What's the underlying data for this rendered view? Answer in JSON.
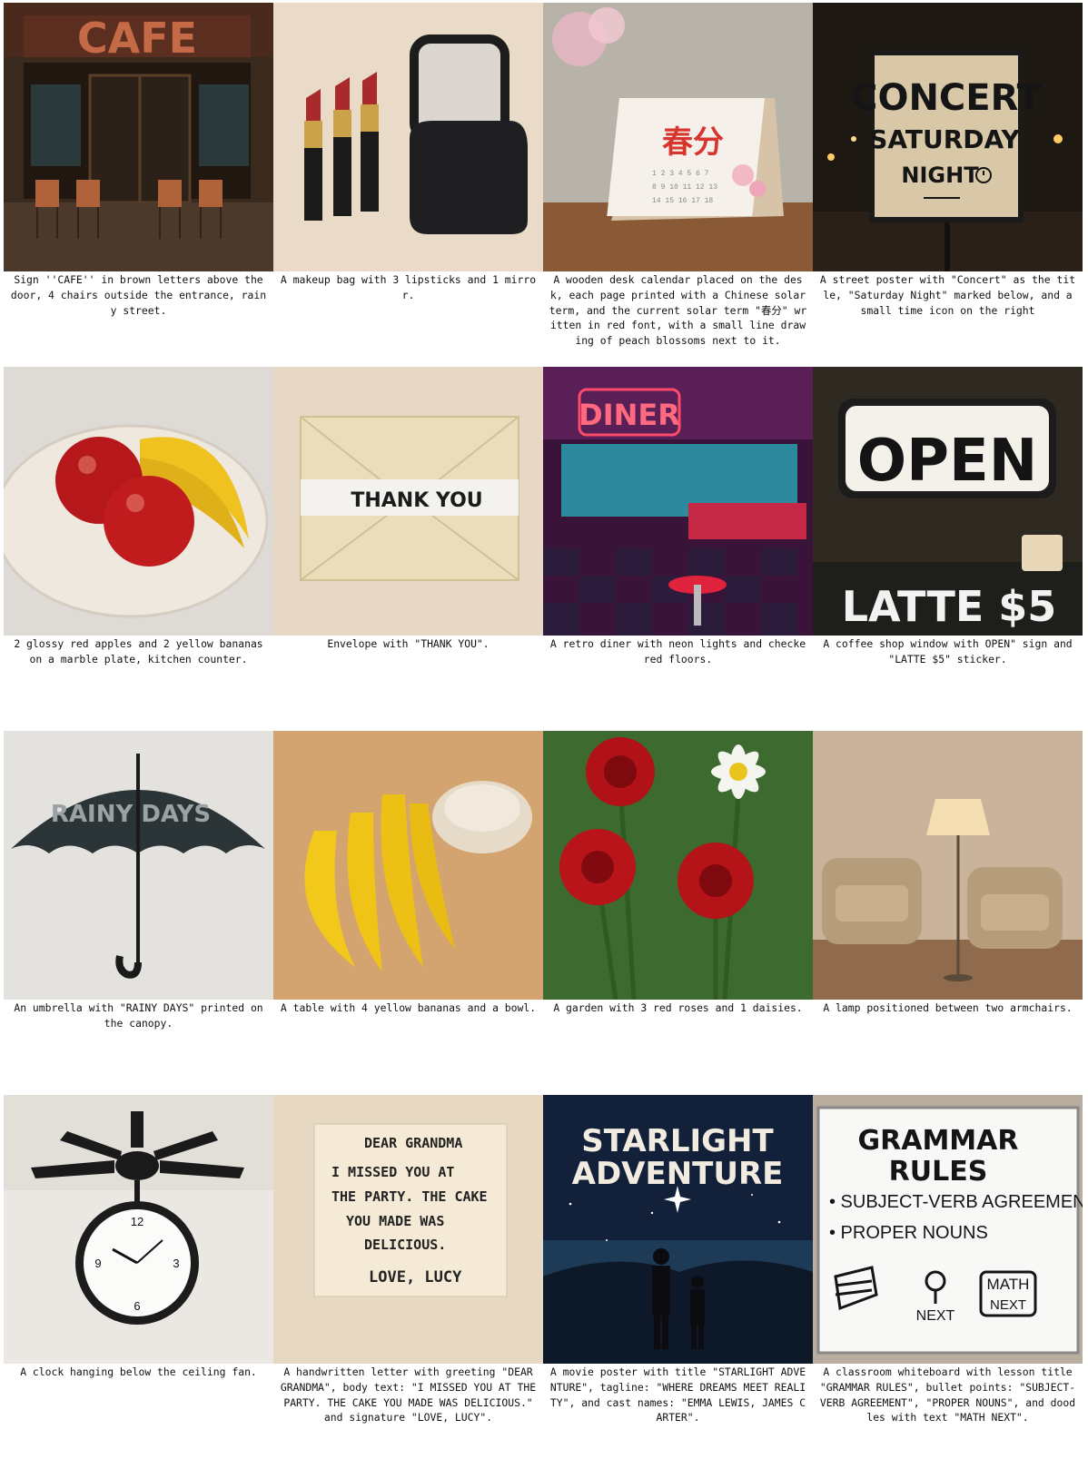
{
  "cells": [
    {
      "sign": "CAFE",
      "caption": "Sign ''CAFE'' in brown letters above the door, 4 chairs outside the entrance, rainy street."
    },
    {
      "caption": "A makeup bag with 3 lipsticks and 1 mirror."
    },
    {
      "sign": "春分",
      "caption": "A wooden desk calendar placed on the desk, each page printed with a Chinese solar term, and the current solar term \"春分\" written in red font, with a small line drawing of peach blossoms next to it."
    },
    {
      "sign_line1": "CONCERT",
      "sign_line2": "SATURDAY",
      "sign_line3": "NIGHT",
      "caption": "A street poster with \"Concert\" as the title, \"Saturday Night\" marked below, and a small time icon on the right"
    },
    {
      "caption": "2 glossy red apples and 2 yellow bananas on a marble plate, kitchen counter."
    },
    {
      "sign": "THANK YOU",
      "caption": "Envelope with \"THANK YOU\"."
    },
    {
      "sign": "DINER",
      "caption": "A retro diner with neon lights and checkered floors."
    },
    {
      "sign": "OPEN",
      "sign2": "LATTE $5",
      "caption": "A coffee shop window with OPEN\" sign and \"LATTE $5\" sticker."
    },
    {
      "sign": "RAINY  DAYS",
      "caption": "An umbrella with \"RAINY DAYS\" printed on the canopy."
    },
    {
      "caption": "A table with 4 yellow bananas and a bowl."
    },
    {
      "caption": "A garden with 3 red roses and 1 daisies."
    },
    {
      "caption": "A lamp positioned between two armchairs."
    },
    {
      "caption": "A clock hanging below the ceiling fan."
    },
    {
      "letter_greeting": "DEAR GRANDMA",
      "letter_l1": "I MISSED YOU AT",
      "letter_l2": "THE PARTY. THE CAKE",
      "letter_l3": "YOU MADE WAS",
      "letter_l4": "DELICIOUS.",
      "letter_sign": "LOVE, LUCY",
      "caption": "A handwritten letter with greeting \"DEAR GRANDMA\", body text: \"I MISSED YOU AT THE PARTY. THE CAKE YOU MADE WAS DELICIOUS.\" and signature \"LOVE, LUCY\"."
    },
    {
      "poster_l1": "STARLIGHT",
      "poster_l2": "ADVENTURE",
      "caption": "A movie poster with title \"STARLIGHT ADVENTURE\", tagline: \"WHERE DREAMS MEET REALITY\", and cast names: \"EMMA LEWIS, JAMES CARTER\"."
    },
    {
      "wb_l1": "GRAMMAR",
      "wb_l2": "RULES",
      "wb_b1": "• SUBJECT-VERB AGREEMENT",
      "wb_b2": "• PROPER NOUNS",
      "wb_next": "NEXT",
      "wb_math": "MATH",
      "wb_next2": "NEXT",
      "caption": "A classroom whiteboard with lesson title \"GRAMMAR RULES\", bullet points: \"SUBJECT-VERB AGREEMENT\", \"PROPER NOUNS\", and doodles with text \"MATH NEXT\"."
    }
  ]
}
